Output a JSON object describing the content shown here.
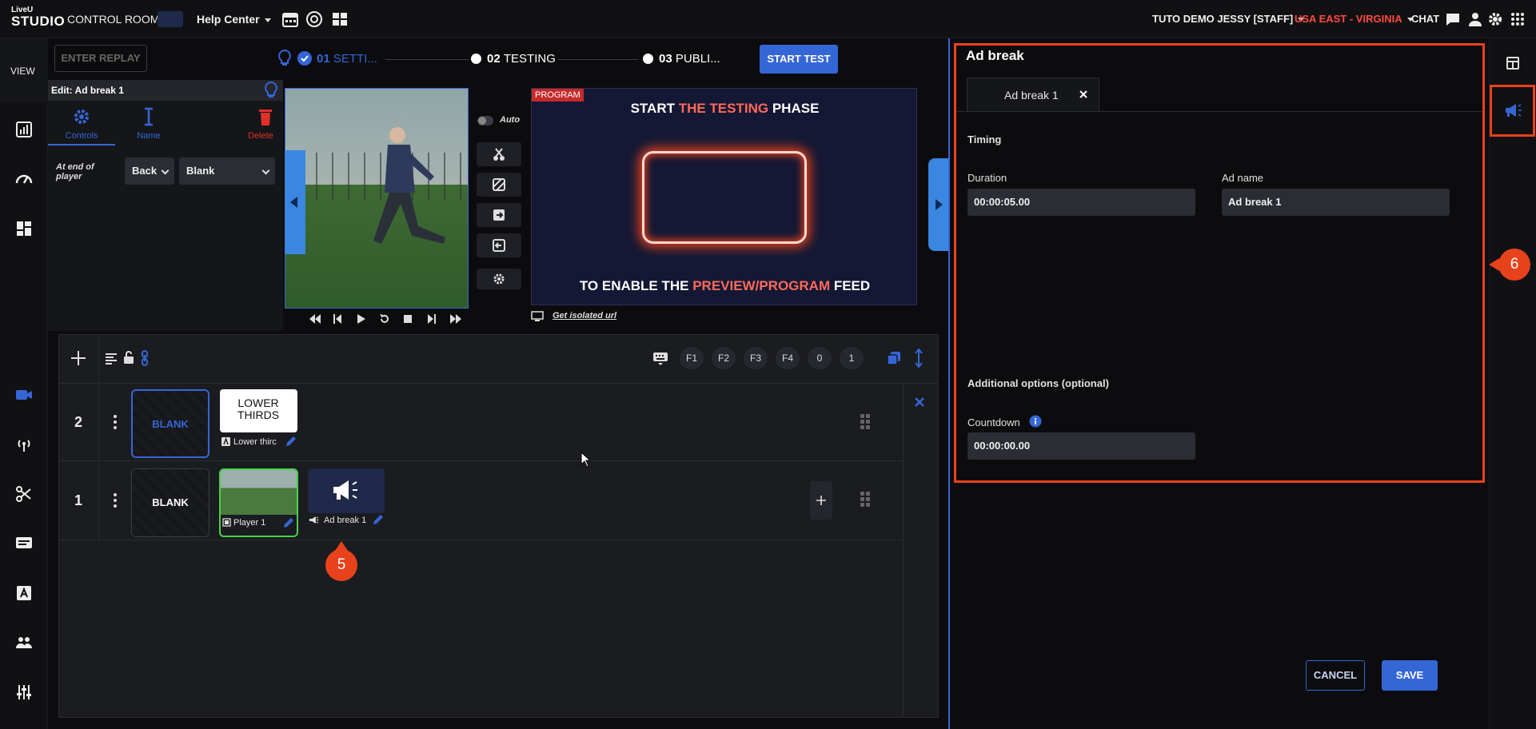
{
  "topbar": {
    "logo_top": "LiveU",
    "logo_main": "STUDIO",
    "control_rooms": "CONTROL ROOMS",
    "help_center": "Help Center",
    "user": "TUTO DEMO JESSY [STAFF]",
    "region": "USA EAST - VIRGINIA",
    "chat": "CHAT"
  },
  "leftrail": {
    "view": "VIEW"
  },
  "stepper": {
    "enter_replay": "ENTER REPLAY",
    "step1_num": "01",
    "step1_label": "SETTI...",
    "step2_num": "02",
    "step2_label": "TESTING",
    "step3_num": "03",
    "step3_label": "PUBLI...",
    "start_test": "START TEST"
  },
  "edit_panel": {
    "title": "Edit: Ad break 1",
    "tab_controls": "Controls",
    "tab_name": "Name",
    "tab_delete": "Delete",
    "end_label": "At end of player",
    "select1": "Back",
    "select2": "Blank"
  },
  "preview": {
    "auto_label": "Auto"
  },
  "program": {
    "badge": "PROGRAM",
    "line1_a": "START ",
    "line1_b": "THE TESTING",
    "line1_c": " PHASE",
    "line2_a": "TO ENABLE THE ",
    "line2_b": "PREVIEW/PROGRAM",
    "line2_c": " FEED",
    "isolated_url": "Get isolated url"
  },
  "timeline": {
    "fkeys": [
      "F1",
      "F2",
      "F3",
      "F4",
      "0",
      "1"
    ],
    "layer2_num": "2",
    "layer1_num": "1",
    "blank": "BLANK",
    "lower_thirds_title": "LOWER THIRDS",
    "lower_thirds_label": "Lower thirc",
    "player_label": "Player 1",
    "adbreak_label": "Ad break 1"
  },
  "adbreak_panel": {
    "heading": "Ad break",
    "tab": "Ad break 1",
    "timing": "Timing",
    "duration_label": "Duration",
    "duration_value": "00:00:05.00",
    "adname_label": "Ad name",
    "adname_value": "Ad break 1",
    "additional": "Additional options (optional)",
    "countdown_label": "Countdown",
    "countdown_value": "00:00:00.00",
    "cancel": "CANCEL",
    "save": "SAVE"
  },
  "callouts": {
    "five": "5",
    "six": "6"
  },
  "colors": {
    "accent": "#3566d6",
    "highlight": "#e8421c",
    "region": "#ff4a3d"
  }
}
